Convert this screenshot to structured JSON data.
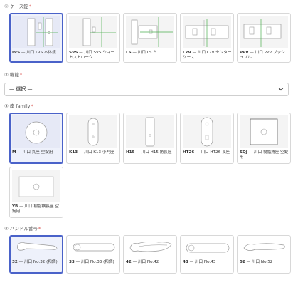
{
  "section_case": {
    "label": "① ケース錠",
    "required_mark": "*",
    "items": [
      {
        "code": "LVS",
        "text": " — 川口 LVS 本体錠"
      },
      {
        "code": "SVS",
        "text": " — 川口 SVS ショートストローク"
      },
      {
        "code": "LS",
        "text": " — 川口 LS ミニ"
      },
      {
        "code": "L7V",
        "text": " — 川口 L7V センターケース"
      },
      {
        "code": "PPV",
        "text": " — 川口 PPV プッシュプル"
      }
    ],
    "selected_index": 0
  },
  "section_function": {
    "label": "② 機能",
    "required_mark": "*",
    "select_value": "— 選択 —"
  },
  "section_base": {
    "label": "③ 座 family",
    "required_mark": "*",
    "items": [
      {
        "code": "M",
        "text": " — 川口 丸座 空錠用"
      },
      {
        "code": "K13",
        "text": " — 川口 K13 小判座"
      },
      {
        "code": "H15",
        "text": " — 川口 H15 角長座"
      },
      {
        "code": "HT26",
        "text": " — 川口 HT26 長座"
      },
      {
        "code": "SQJ",
        "text": " — 川口 樹脂角座 空錠用"
      },
      {
        "code": "YB",
        "text": " — 川口 樹脂横長座 空錠用"
      }
    ],
    "selected_index": 0
  },
  "section_handle": {
    "label": "④ ハンドル番号",
    "required_mark": "*",
    "items": [
      {
        "code": "32",
        "text": " — 川口 No.32 (和調)"
      },
      {
        "code": "33",
        "text": " — 川口 No.33 (和調)"
      },
      {
        "code": "42",
        "text": " — 川口 No.42"
      },
      {
        "code": "43",
        "text": " — 川口 No.43"
      },
      {
        "code": "52",
        "text": " — 川口 No.52"
      }
    ],
    "selected_index": 0
  },
  "colors": {
    "accent": "#4a62c9",
    "required": "#d9534f",
    "line_green": "#4caf50"
  }
}
